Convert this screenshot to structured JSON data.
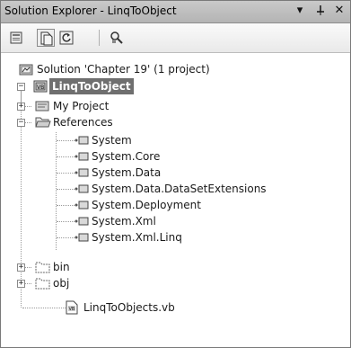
{
  "window": {
    "title": "Solution Explorer - LinqToObject",
    "dropdown_icon": "chevron-down-icon",
    "pin_icon": "pin-icon",
    "close_icon": "close-icon",
    "dropdown_glyph": "▾",
    "pin_glyph": "ᐅ",
    "close_glyph": "✕"
  },
  "toolbar": {
    "buttons": [
      {
        "name": "properties-button",
        "icon": "properties-icon"
      },
      {
        "name": "show-all-files-button",
        "icon": "show-all-files-icon"
      },
      {
        "name": "refresh-button",
        "icon": "refresh-icon"
      },
      {
        "name": "class-view-button",
        "icon": "class-view-icon"
      }
    ]
  },
  "tree": {
    "solution": "Solution 'Chapter 19' (1 project)",
    "project": "LinqToObject",
    "my_project": "My Project",
    "references": {
      "label": "References",
      "items": [
        "System",
        "System.Core",
        "System.Data",
        "System.Data.DataSetExtensions",
        "System.Deployment",
        "System.Xml",
        "System.Xml.Linq"
      ]
    },
    "bin": "bin",
    "obj": "obj",
    "file": "LinqToObjects.vb"
  }
}
